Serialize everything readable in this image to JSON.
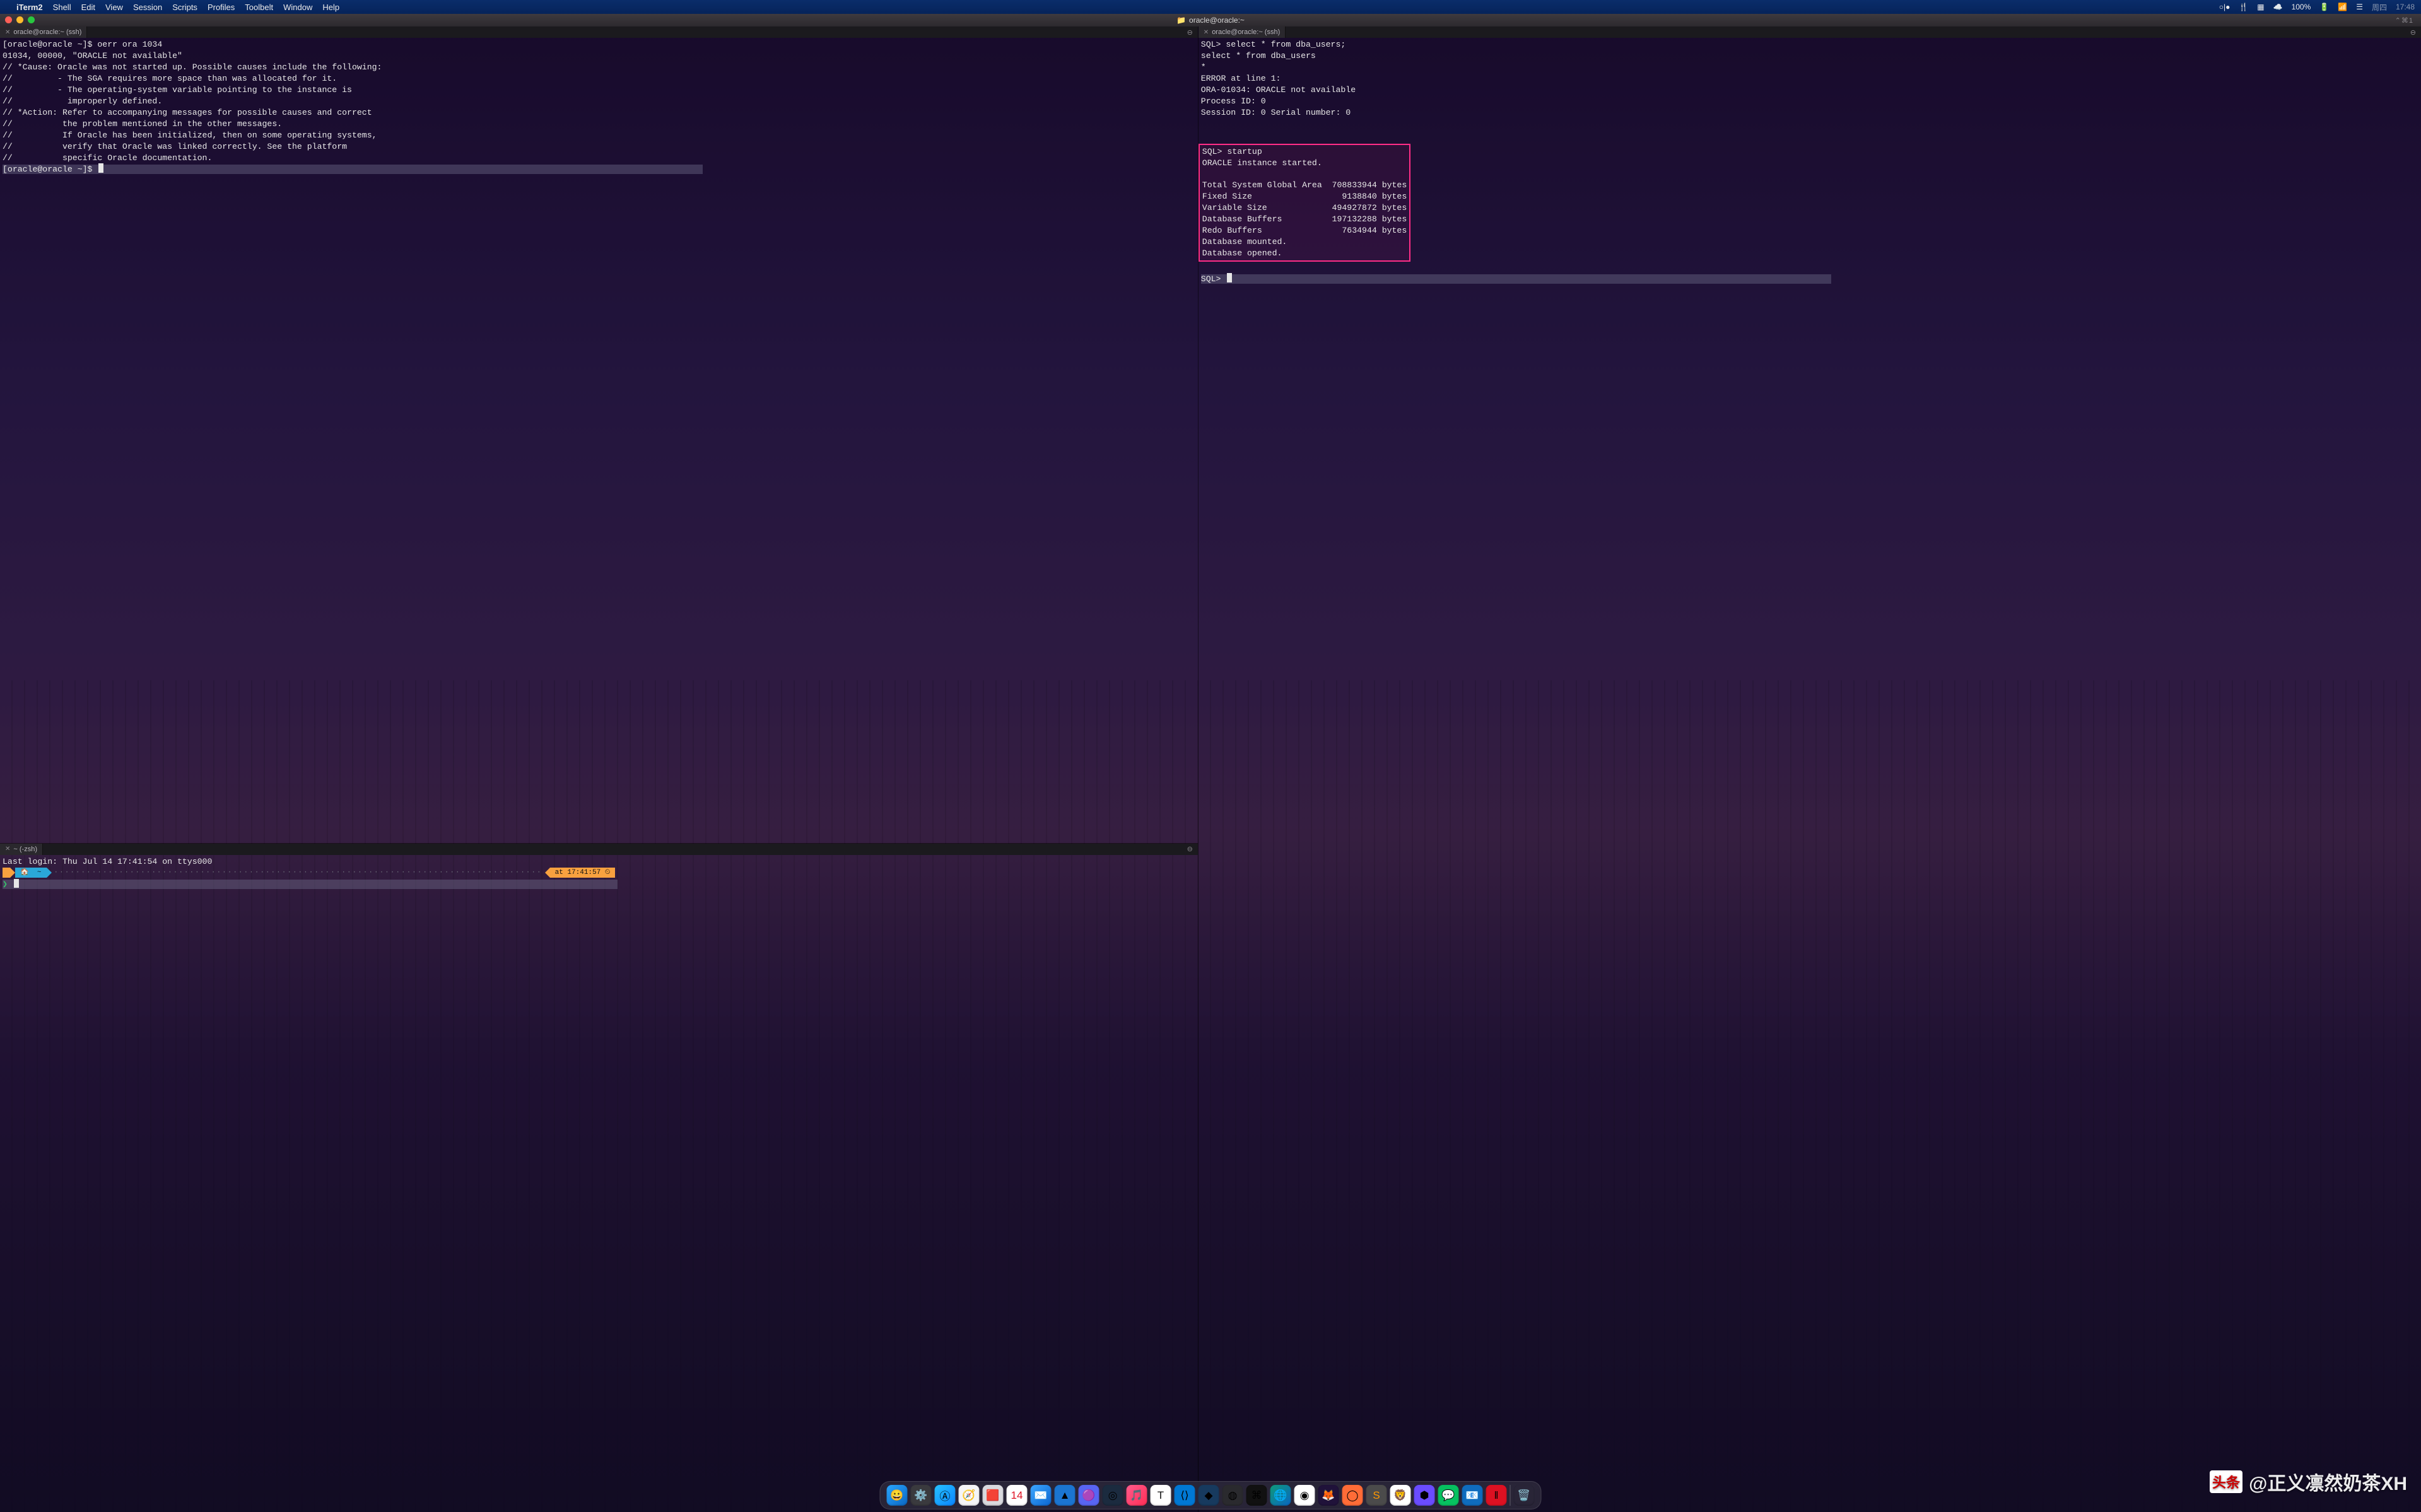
{
  "menubar": {
    "app": "iTerm2",
    "items": [
      "Shell",
      "Edit",
      "View",
      "Session",
      "Scripts",
      "Profiles",
      "Toolbelt",
      "Window",
      "Help"
    ],
    "status": {
      "battery_pct": "100%",
      "battery_icon": "🔋",
      "time": "17:48",
      "day": "周四"
    }
  },
  "titlebar": {
    "title": "oracle@oracle:~",
    "badge": "⌃⌘1"
  },
  "tabs": {
    "top_left": "oracle@oracle:~ (ssh)",
    "bot_left": "~ (-zsh)",
    "right": "oracle@oracle:~ (ssh)"
  },
  "pane_tl": {
    "lines": [
      "[oracle@oracle ~]$ oerr ora 1034",
      "01034, 00000, \"ORACLE not available\"",
      "// *Cause: Oracle was not started up. Possible causes include the following:",
      "//         - The SGA requires more space than was allocated for it.",
      "//         - The operating-system variable pointing to the instance is",
      "//           improperly defined.",
      "// *Action: Refer to accompanying messages for possible causes and correct",
      "//          the problem mentioned in the other messages.",
      "//          If Oracle has been initialized, then on some operating systems,",
      "//          verify that Oracle was linked correctly. See the platform",
      "//          specific Oracle documentation."
    ],
    "prompt": "[oracle@oracle ~]$ "
  },
  "pane_bl": {
    "last_login": "Last login: Thu Jul 14 17:41:54 on ttys000",
    "home_seg": "🏠  ~",
    "time_seg": "at 17:41:57 ⏲",
    "prompt": "❯ "
  },
  "pane_r": {
    "pre_lines": [
      "SQL> select * from dba_users;",
      "select * from dba_users",
      "*",
      "ERROR at line 1:",
      "ORA-01034: ORACLE not available",
      "Process ID: 0",
      "Session ID: 0 Serial number: 0",
      "",
      ""
    ],
    "box_lines": [
      "SQL> startup",
      "ORACLE instance started.",
      "",
      "Total System Global Area  708833944 bytes",
      "Fixed Size                  9138840 bytes",
      "Variable Size             494927872 bytes",
      "Database Buffers          197132288 bytes",
      "Redo Buffers                7634944 bytes",
      "Database mounted.",
      "Database opened."
    ],
    "prompt": "SQL> "
  },
  "dock": {
    "items": [
      {
        "n": "finder",
        "e": "😀",
        "bg": "linear-gradient(135deg,#2aa7ff,#0a66c2)"
      },
      {
        "n": "settings",
        "e": "⚙️",
        "bg": "#3a3a3e"
      },
      {
        "n": "appstore",
        "e": "Ⓐ",
        "bg": "linear-gradient(135deg,#27c2ff,#0a84ff)"
      },
      {
        "n": "safari",
        "e": "🧭",
        "bg": "#f5f5f7"
      },
      {
        "n": "launchpad",
        "e": "🟥",
        "bg": "#d9d9de"
      },
      {
        "n": "calendar",
        "e": "14",
        "bg": "#fff",
        "fg": "#d12"
      },
      {
        "n": "mail",
        "e": "✉️",
        "bg": "linear-gradient(135deg,#3da7ff,#0a66d0)"
      },
      {
        "n": "app1",
        "e": "▲",
        "bg": "#1b75d0"
      },
      {
        "n": "discord",
        "e": "🟣",
        "bg": "#5865f2"
      },
      {
        "n": "app2",
        "e": "◎",
        "bg": "#1b2b3f"
      },
      {
        "n": "music",
        "e": "🎵",
        "bg": "linear-gradient(135deg,#ff5c8d,#ff2d55)"
      },
      {
        "n": "typora",
        "e": "T",
        "bg": "#fff",
        "fg": "#111"
      },
      {
        "n": "vscode",
        "e": "⟨⟩",
        "bg": "#0078d4"
      },
      {
        "n": "app3",
        "e": "◆",
        "bg": "#173a5e"
      },
      {
        "n": "chrome-dev",
        "e": "◍",
        "bg": "#2a2a2e"
      },
      {
        "n": "terminal",
        "e": "⌘",
        "bg": "#111"
      },
      {
        "n": "edge",
        "e": "🌐",
        "bg": "linear-gradient(135deg,#0f9a7a,#0a66c2)"
      },
      {
        "n": "chrome",
        "e": "◉",
        "bg": "#fff"
      },
      {
        "n": "firefox",
        "e": "🦊",
        "bg": "#20123a"
      },
      {
        "n": "postman",
        "e": "◯",
        "bg": "#ff6c37"
      },
      {
        "n": "sublime",
        "e": "S",
        "bg": "#4b4b4b",
        "fg": "#ff9800"
      },
      {
        "n": "brave",
        "e": "🦁",
        "bg": "#fff"
      },
      {
        "n": "app4",
        "e": "⬢",
        "bg": "#6a4cff"
      },
      {
        "n": "wechat",
        "e": "💬",
        "bg": "#07c160"
      },
      {
        "n": "outlook",
        "e": "📧",
        "bg": "#0f6cbd"
      },
      {
        "n": "app5",
        "e": "‖",
        "bg": "#d12"
      },
      {
        "n": "sep",
        "sep": true
      },
      {
        "n": "trash",
        "e": "🗑️",
        "bg": "transparent"
      }
    ]
  },
  "watermark": {
    "logo": "头条",
    "text": "@正义凛然奶茶XH"
  }
}
